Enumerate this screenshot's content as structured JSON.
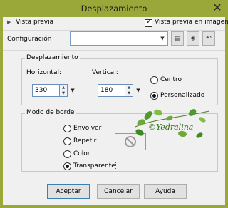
{
  "window": {
    "title": "Desplazamiento",
    "close_glyph": "✕",
    "frame_color": "#9aa83a"
  },
  "preview": {
    "toggle_label": "Vista previa",
    "image_checkbox_label": "Vista previa en imagen",
    "image_checked": true
  },
  "config": {
    "label": "Configuración",
    "value": "",
    "tool_icons": [
      "save-icon",
      "randomize-icon",
      "reset-icon"
    ]
  },
  "offset": {
    "group_title": "Desplazamiento",
    "horizontal_label": "Horizontal:",
    "horizontal_value": "330",
    "vertical_label": "Vertical:",
    "vertical_value": "180",
    "mode_options": [
      {
        "label": "Centro",
        "selected": false
      },
      {
        "label": "Personalizado",
        "selected": true
      }
    ]
  },
  "edge": {
    "group_title": "Modo de borde",
    "options": [
      {
        "label": "Envolver",
        "selected": false
      },
      {
        "label": "Repetir",
        "selected": false
      },
      {
        "label": "Color",
        "selected": false
      },
      {
        "label": "Transparente",
        "selected": true
      }
    ]
  },
  "watermark": {
    "text": "©Yedralina"
  },
  "buttons": {
    "ok": "Aceptar",
    "cancel": "Cancelar",
    "help": "Ayuda"
  }
}
